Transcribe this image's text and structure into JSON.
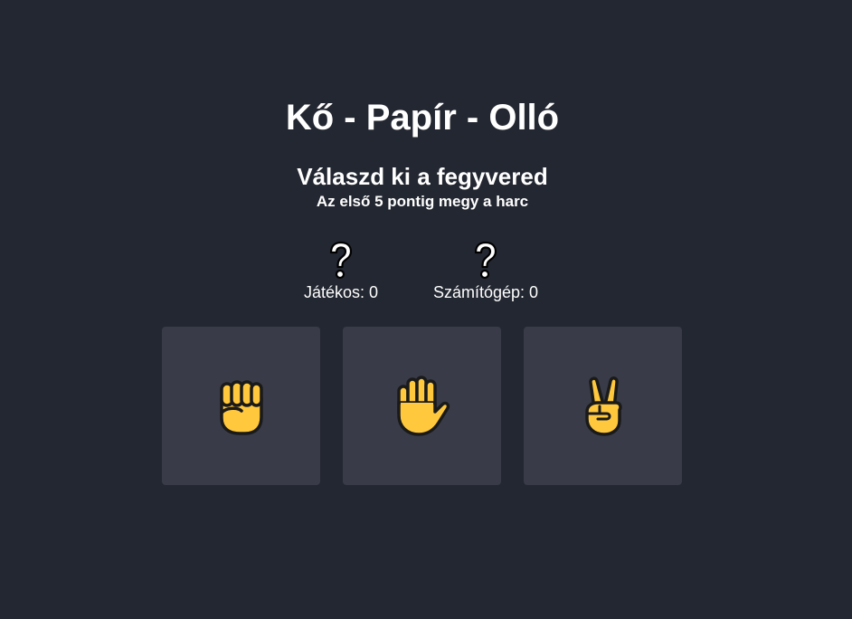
{
  "header": {
    "title": "Kő - Papír - Olló",
    "subtitle": "Válaszd ki a fegyvered",
    "rules": "Az első 5 pontig megy a harc"
  },
  "scoreboard": {
    "player": {
      "choice_icon": "question-mark-icon",
      "label": "Játékos: 0",
      "score": 0
    },
    "computer": {
      "choice_icon": "question-mark-icon",
      "label": "Számítógép: 0",
      "score": 0
    }
  },
  "weapons": [
    {
      "id": "rock",
      "icon": "raised-fist-icon"
    },
    {
      "id": "paper",
      "icon": "raised-hand-icon"
    },
    {
      "id": "scissors",
      "icon": "victory-hand-icon"
    }
  ],
  "colors": {
    "background": "#232731",
    "card": "#393c48",
    "text": "#ffffff",
    "emoji_skin": "#ffc83d",
    "emoji_outline": "#1a1a1a"
  }
}
